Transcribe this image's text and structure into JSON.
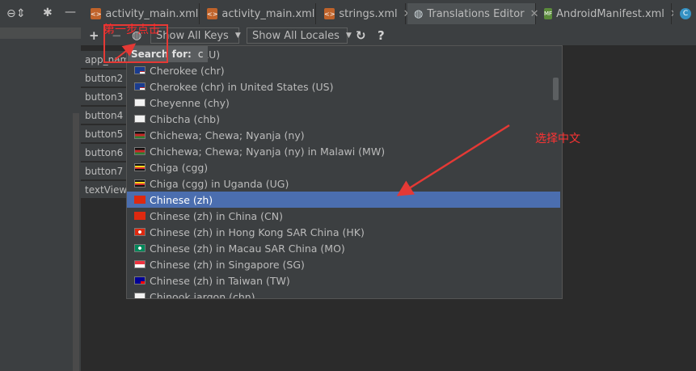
{
  "tabs": [
    {
      "label": "activity_main.xml",
      "icon": "xml-file-icon"
    },
    {
      "label": "activity_main.xml",
      "icon": "xml-file-icon"
    },
    {
      "label": "strings.xml",
      "icon": "xml-file-icon"
    },
    {
      "label": "Translations Editor",
      "icon": "globe-icon",
      "active": true
    },
    {
      "label": "AndroidManifest.xml",
      "icon": "manifest-file-icon"
    }
  ],
  "toolbar": {
    "add": "+",
    "remove": "−",
    "keys_filter": "Show All Keys",
    "locales_filter": "Show All Locales",
    "help": "?"
  },
  "keys": [
    "app_name",
    "button2",
    "button3",
    "button4",
    "button5",
    "button6",
    "button7",
    "textView"
  ],
  "search": {
    "label": "Search for:",
    "query": "c"
  },
  "locales": [
    {
      "label": "in Russia (RU)",
      "flag": "russia"
    },
    {
      "label": "Cherokee (chr)",
      "flag": "us"
    },
    {
      "label": "Cherokee (chr) in United States (US)",
      "flag": "us"
    },
    {
      "label": "Cheyenne (chy)",
      "flag": "blank"
    },
    {
      "label": "Chibcha (chb)",
      "flag": "blank"
    },
    {
      "label": "Chichewa; Chewa; Nyanja (ny)",
      "flag": "malawi"
    },
    {
      "label": "Chichewa; Chewa; Nyanja (ny) in Malawi (MW)",
      "flag": "malawi"
    },
    {
      "label": "Chiga (cgg)",
      "flag": "uganda"
    },
    {
      "label": "Chiga (cgg) in Uganda (UG)",
      "flag": "uganda"
    },
    {
      "label": "Chinese (zh)",
      "flag": "china",
      "selected": true
    },
    {
      "label": "Chinese (zh) in China (CN)",
      "flag": "china"
    },
    {
      "label": "Chinese (zh) in Hong Kong SAR China (HK)",
      "flag": "hongkong"
    },
    {
      "label": "Chinese (zh) in Macau SAR China (MO)",
      "flag": "macau"
    },
    {
      "label": "Chinese (zh) in Singapore (SG)",
      "flag": "singapore"
    },
    {
      "label": "Chinese (zh) in Taiwan (TW)",
      "flag": "taiwan"
    },
    {
      "label": "Chinook jargon (chn)",
      "flag": "blank"
    }
  ],
  "annotations": {
    "step_one": "第一步点击",
    "choose_chinese": "选择中文",
    "color": "#e53935"
  },
  "colors": {
    "selection": "#4b6eaf",
    "background": "#2b2b2b",
    "panel": "#3c3f41"
  }
}
